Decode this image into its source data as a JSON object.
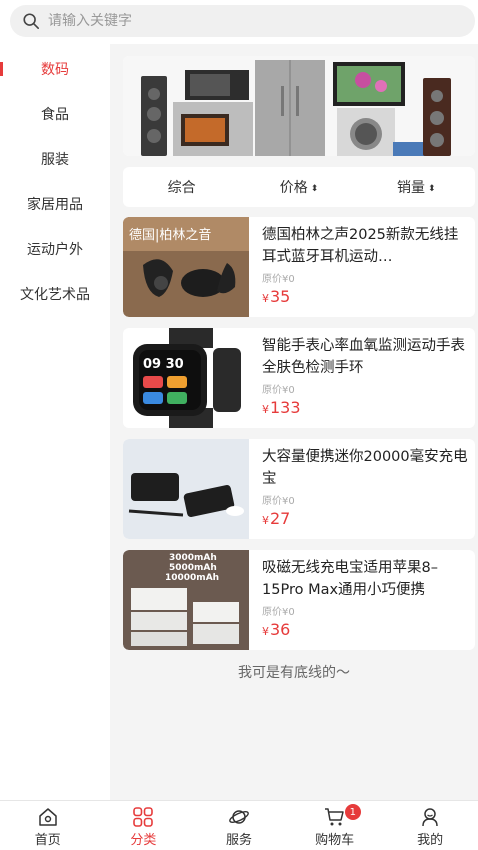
{
  "search": {
    "placeholder": "请输入关键字"
  },
  "sidebar": {
    "items": [
      {
        "label": "数码",
        "active": true
      },
      {
        "label": "食品"
      },
      {
        "label": "服装"
      },
      {
        "label": "家居用品"
      },
      {
        "label": "运动户外"
      },
      {
        "label": "文化艺术品"
      }
    ]
  },
  "sort": {
    "items": [
      {
        "label": "综合"
      },
      {
        "label": "价格"
      },
      {
        "label": "销量"
      }
    ],
    "arrow": "⬍"
  },
  "products": [
    {
      "name": "德国柏林之声2025新款无线挂耳式蓝牙耳机运动…",
      "orig_price": "原价¥0",
      "currency": "¥",
      "price": "35",
      "image_text": "德国|柏林之音"
    },
    {
      "name": "智能手表心率血氧监测运动手表全肤色检测手环",
      "orig_price": "原价¥0",
      "currency": "¥",
      "price": "133",
      "image_text": "09 30"
    },
    {
      "name": "大容量便携迷你20000毫安充电宝",
      "orig_price": "原价¥0",
      "currency": "¥",
      "price": "27"
    },
    {
      "name": "吸磁无线充电宝适用苹果8–15Pro Max通用小巧便携",
      "orig_price": "原价¥0",
      "currency": "¥",
      "price": "36",
      "image_lines": [
        "3000mAh",
        "5000mAh",
        "10000mAh"
      ]
    }
  ],
  "footer_text": "我可是有底线的～",
  "tabbar": {
    "items": [
      {
        "label": "首页",
        "icon": "home-icon"
      },
      {
        "label": "分类",
        "icon": "category-icon",
        "active": true
      },
      {
        "label": "服务",
        "icon": "planet-icon"
      },
      {
        "label": "购物车",
        "icon": "cart-icon",
        "badge": "1"
      },
      {
        "label": "我的",
        "icon": "user-icon"
      }
    ]
  },
  "colors": {
    "accent": "#e63b3b",
    "background": "#f4f4f4"
  }
}
